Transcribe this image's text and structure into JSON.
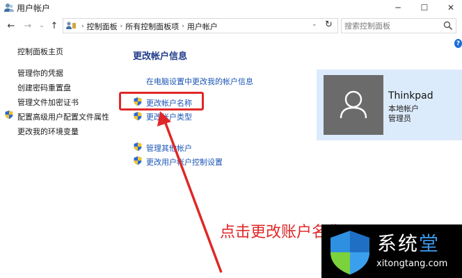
{
  "window": {
    "title": "用户帐户",
    "minimize_glyph": "─",
    "maximize_glyph": "☐",
    "close_glyph": "✕"
  },
  "nav": {
    "back_glyph": "←",
    "forward_glyph": "→",
    "dropdown_glyph": "⌄",
    "up_glyph": "↑",
    "refresh_glyph": "↻"
  },
  "address": {
    "crumbs": [
      "控制面板",
      "所有控制面板项",
      "用户帐户"
    ],
    "separator": "›",
    "dropdown_glyph": "⌄"
  },
  "search": {
    "placeholder": "搜索控制面板",
    "icon": "search-icon"
  },
  "help": {
    "glyph": "?"
  },
  "sidebar": {
    "items": [
      {
        "label": "控制面板主页",
        "shield": false
      },
      {
        "label": "管理你的凭据",
        "shield": false
      },
      {
        "label": "创建密码重置盘",
        "shield": false
      },
      {
        "label": "管理文件加密证书",
        "shield": false
      },
      {
        "label": "配置高级用户配置文件属性",
        "shield": true
      },
      {
        "label": "更改我的环境变量",
        "shield": false
      }
    ]
  },
  "main": {
    "heading": "更改帐户信息",
    "links": [
      {
        "label": "在电脑设置中更改我的帐户信息",
        "shield": false
      },
      {
        "label": "更改帐户名称",
        "shield": true
      },
      {
        "label": "更改帐户类型",
        "shield": true
      },
      {
        "label": "管理其他帐户",
        "shield": true
      },
      {
        "label": "更改用户帐户控制设置",
        "shield": true
      }
    ]
  },
  "account": {
    "name": "Thinkpad",
    "type": "本地帐户",
    "role": "管理员",
    "avatar_icon": "user-icon"
  },
  "annotation": {
    "text": "点击更改账户名称",
    "color": "#e02727"
  },
  "watermark": {
    "title_a": "系统",
    "title_b": "堂",
    "url": "xitongtang.com"
  },
  "colors": {
    "link": "#1a55b5",
    "heading": "#1e3a8a",
    "card_bg": "#dcebfb",
    "avatar_bg": "#6b6b6b"
  }
}
